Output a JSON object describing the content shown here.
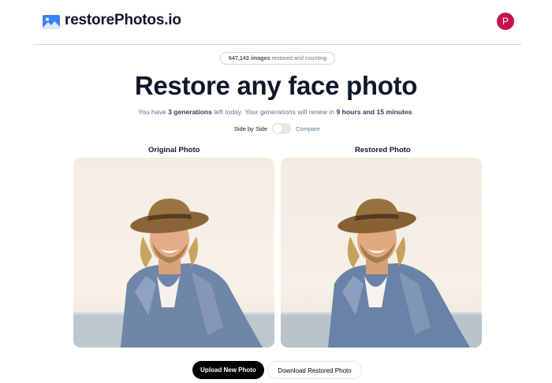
{
  "header": {
    "brand": "restorePhotos.io",
    "avatar_initial": "P",
    "avatar_color": "#c4124f"
  },
  "counter": {
    "count": "647,143 images",
    "suffix": " restored and counting"
  },
  "hero": {
    "title": "Restore any face photo"
  },
  "generations": {
    "prefix": "You have ",
    "count": "3 generations",
    "middle": " left today. Your generations will renew in ",
    "renew_time": "9 hours and 15 minutes",
    "suffix": "."
  },
  "view_toggle": {
    "left_label": "Side by Side",
    "right_label": "Compare",
    "compare_enabled": false
  },
  "photos": {
    "original_label": "Original Photo",
    "restored_label": "Restored Photo"
  },
  "actions": {
    "upload_label": "Upload New Photo",
    "download_label": "Download Restored Photo"
  }
}
